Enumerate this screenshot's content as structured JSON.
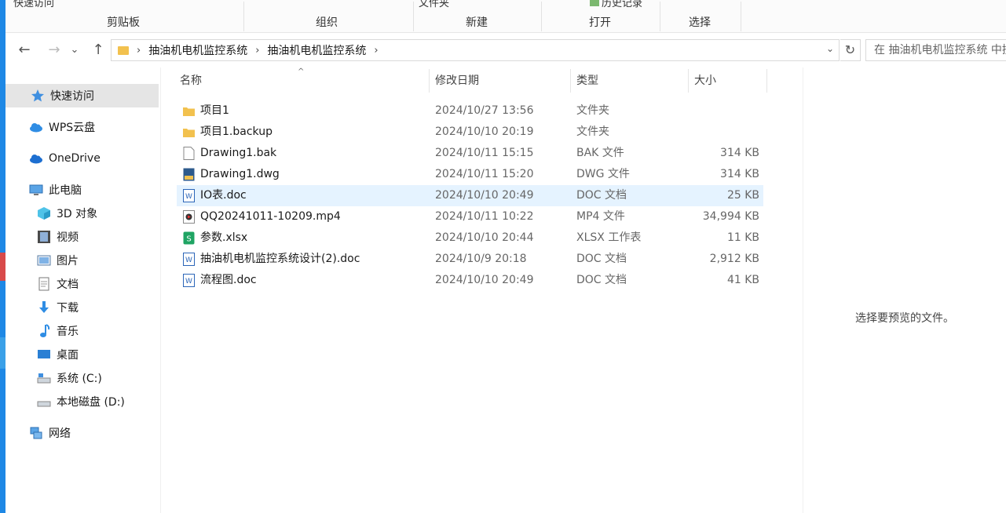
{
  "ribbon": {
    "top_left": "快速访问",
    "top_mid": "文件夹",
    "top_right": "历史记录",
    "groups": [
      "剪贴板",
      "组织",
      "新建",
      "打开",
      "选择"
    ]
  },
  "nav": {
    "back": "←",
    "forward": "→",
    "recent": "⌄",
    "up": "↑",
    "breadcrumb": [
      "抽油机电机监控系统",
      "抽油机电机监控系统"
    ],
    "search_placeholder": "在 抽油机电机监控系统 中搜索"
  },
  "sidebar": {
    "items": [
      {
        "label": "快速访问",
        "icon": "star-icon"
      },
      {
        "label": "WPS云盘",
        "icon": "cloud-icon"
      },
      {
        "label": "OneDrive",
        "icon": "onedrive-icon"
      },
      {
        "label": "此电脑",
        "icon": "computer-icon"
      },
      {
        "label": "3D 对象",
        "icon": "cube-icon"
      },
      {
        "label": "视频",
        "icon": "film-icon"
      },
      {
        "label": "图片",
        "icon": "picture-icon"
      },
      {
        "label": "文档",
        "icon": "document-icon"
      },
      {
        "label": "下载",
        "icon": "download-icon"
      },
      {
        "label": "音乐",
        "icon": "music-icon"
      },
      {
        "label": "桌面",
        "icon": "desktop-icon"
      },
      {
        "label": "系统 (C:)",
        "icon": "drive-icon"
      },
      {
        "label": "本地磁盘 (D:)",
        "icon": "drive-icon"
      },
      {
        "label": "网络",
        "icon": "network-icon"
      }
    ]
  },
  "columns": {
    "name": "名称",
    "date": "修改日期",
    "type": "类型",
    "size": "大小"
  },
  "files": [
    {
      "name": "项目1",
      "date": "2024/10/27 13:56",
      "type": "文件夹",
      "size": "",
      "icon": "folder-icon"
    },
    {
      "name": "项目1.backup",
      "date": "2024/10/10 20:19",
      "type": "文件夹",
      "size": "",
      "icon": "folder-icon"
    },
    {
      "name": "Drawing1.bak",
      "date": "2024/10/11 15:15",
      "type": "BAK 文件",
      "size": "314 KB",
      "icon": "blank-file-icon"
    },
    {
      "name": "Drawing1.dwg",
      "date": "2024/10/11 15:20",
      "type": "DWG 文件",
      "size": "314 KB",
      "icon": "dwg-file-icon"
    },
    {
      "name": "IO表.doc",
      "date": "2024/10/10 20:49",
      "type": "DOC 文档",
      "size": "25 KB",
      "icon": "word-doc-icon"
    },
    {
      "name": "QQ20241011-10209.mp4",
      "date": "2024/10/11 10:22",
      "type": "MP4 文件",
      "size": "34,994 KB",
      "icon": "video-file-icon"
    },
    {
      "name": "参数.xlsx",
      "date": "2024/10/10 20:44",
      "type": "XLSX 工作表",
      "size": "11 KB",
      "icon": "spreadsheet-icon"
    },
    {
      "name": "抽油机电机监控系统设计(2).doc",
      "date": "2024/10/9 20:18",
      "type": "DOC 文档",
      "size": "2,912 KB",
      "icon": "word-doc-icon"
    },
    {
      "name": "流程图.doc",
      "date": "2024/10/10 20:49",
      "type": "DOC 文档",
      "size": "41 KB",
      "icon": "word-doc-icon"
    }
  ],
  "preview": {
    "message": "选择要预览的文件。"
  },
  "colors": {
    "accent": "#1e88e5",
    "folder": "#f2c14e",
    "hover": "#e5f3ff",
    "selected": "#e5e5e5"
  }
}
